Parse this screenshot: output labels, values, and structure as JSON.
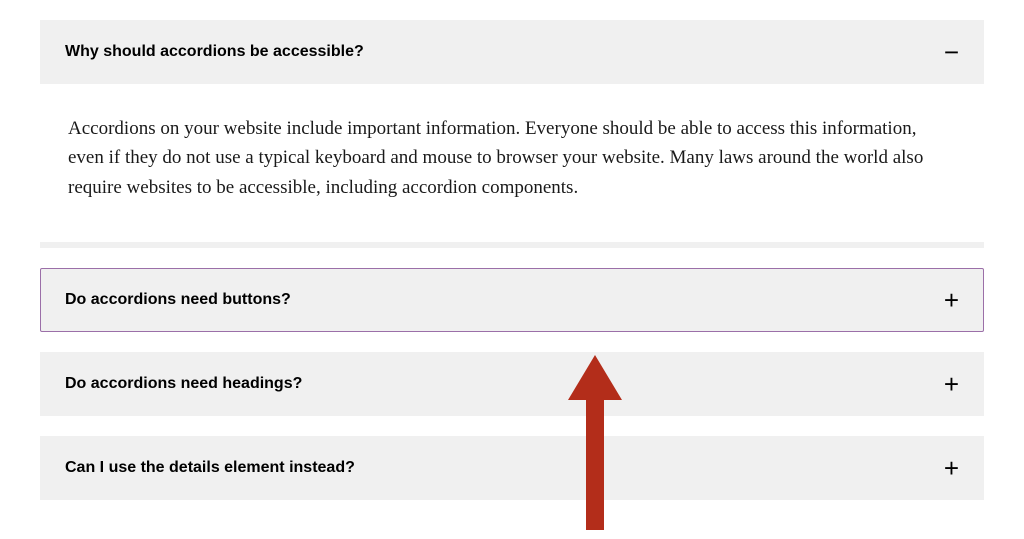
{
  "accordion": {
    "items": [
      {
        "label": "Why should accordions be accessible?",
        "expanded": true,
        "icon": "−",
        "content": "Accordions on your website include important information. Everyone should be able to access this information, even if they do not use a typical keyboard and mouse to browser your website. Many laws around the world also require websites to be accessible, including accordion components."
      },
      {
        "label": "Do accordions need buttons?",
        "expanded": false,
        "icon": "+",
        "focused": true
      },
      {
        "label": "Do accordions need headings?",
        "expanded": false,
        "icon": "+"
      },
      {
        "label": "Can I use the details element instead?",
        "expanded": false,
        "icon": "+"
      }
    ]
  },
  "annotation": {
    "arrow_color": "#b32d1a"
  }
}
